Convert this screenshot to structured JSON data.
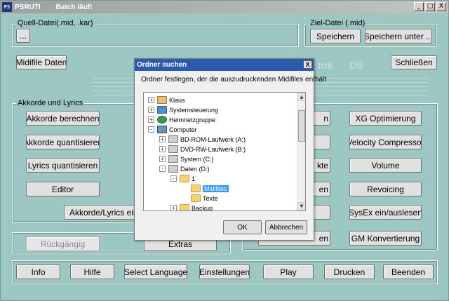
{
  "window": {
    "app_name": "PSRUTI",
    "subtitle": "Batch läuft",
    "min_label": "_",
    "max_label": "□",
    "close_label": "X"
  },
  "quell": {
    "group_label": "Quell-Datei(.mid, .kar)",
    "browse_label": "..."
  },
  "ziel": {
    "group_label": "Ziel-Datei (.mid)",
    "save_label": "Speichern",
    "save_as_label": "Speichern unter ..."
  },
  "midifile_daten_label": "Midifile Daten",
  "schliessen_label": "Schließen",
  "chord_display": [
    "m6",
    "D6"
  ],
  "akkorde": {
    "group_label": "Akkorde und Lyrics",
    "buttons": [
      "Akkorde berechnen",
      "Akkorde quantisieren",
      "Lyrics quantisieren",
      "Editor",
      "Akkorde/Lyrics ein-/"
    ]
  },
  "right_buttons": [
    "XG Optimierung",
    "Velocity Compressor",
    "Volume",
    "Revoicing",
    "SysEx ein/auslesen",
    "GM Konvertierung"
  ],
  "hidden_fragments": [
    "n",
    "kte",
    "en",
    "en"
  ],
  "rueckgaengig_label": "Rückgängig",
  "extras_label": "Extras",
  "bottom_buttons": [
    "Info",
    "Hilfe",
    "Select Language",
    "Einstellungen",
    "Play",
    "Drucken",
    "Beenden"
  ],
  "dialog": {
    "title": "Ordner suchen",
    "close_label": "X",
    "description": "Ordner festlegen, der die auszudruckenden Midifiles enthält",
    "tree": [
      {
        "label": "Klaus",
        "icon": "user-folder-icon",
        "exp": "+"
      },
      {
        "label": "Systemsteuerung",
        "icon": "control-panel-icon",
        "exp": "+"
      },
      {
        "label": "Heimnetzgruppe",
        "icon": "homegroup-icon",
        "exp": "+"
      },
      {
        "label": "Computer",
        "icon": "computer-icon",
        "exp": "-"
      },
      {
        "label": "BD-ROM-Laufwerk (A:)",
        "icon": "optical-drive-icon",
        "exp": "+"
      },
      {
        "label": "DVD-RW-Laufwerk (B:)",
        "icon": "optical-drive-icon",
        "exp": "+"
      },
      {
        "label": "System (C:)",
        "icon": "hard-drive-icon",
        "exp": "+"
      },
      {
        "label": "Daten (D:)",
        "icon": "hard-drive-icon",
        "exp": "-"
      },
      {
        "label": "1",
        "icon": "folder-icon",
        "exp": "-"
      },
      {
        "label": "Midifiles",
        "icon": "folder-icon",
        "exp": "",
        "selected": true
      },
      {
        "label": "Texte",
        "icon": "folder-icon",
        "exp": ""
      },
      {
        "label": "Backup",
        "icon": "folder-icon",
        "exp": "+"
      }
    ],
    "scroll_up": "▲",
    "scroll_down": "▼",
    "ok_label": "OK",
    "cancel_label": "Abbrechen"
  }
}
